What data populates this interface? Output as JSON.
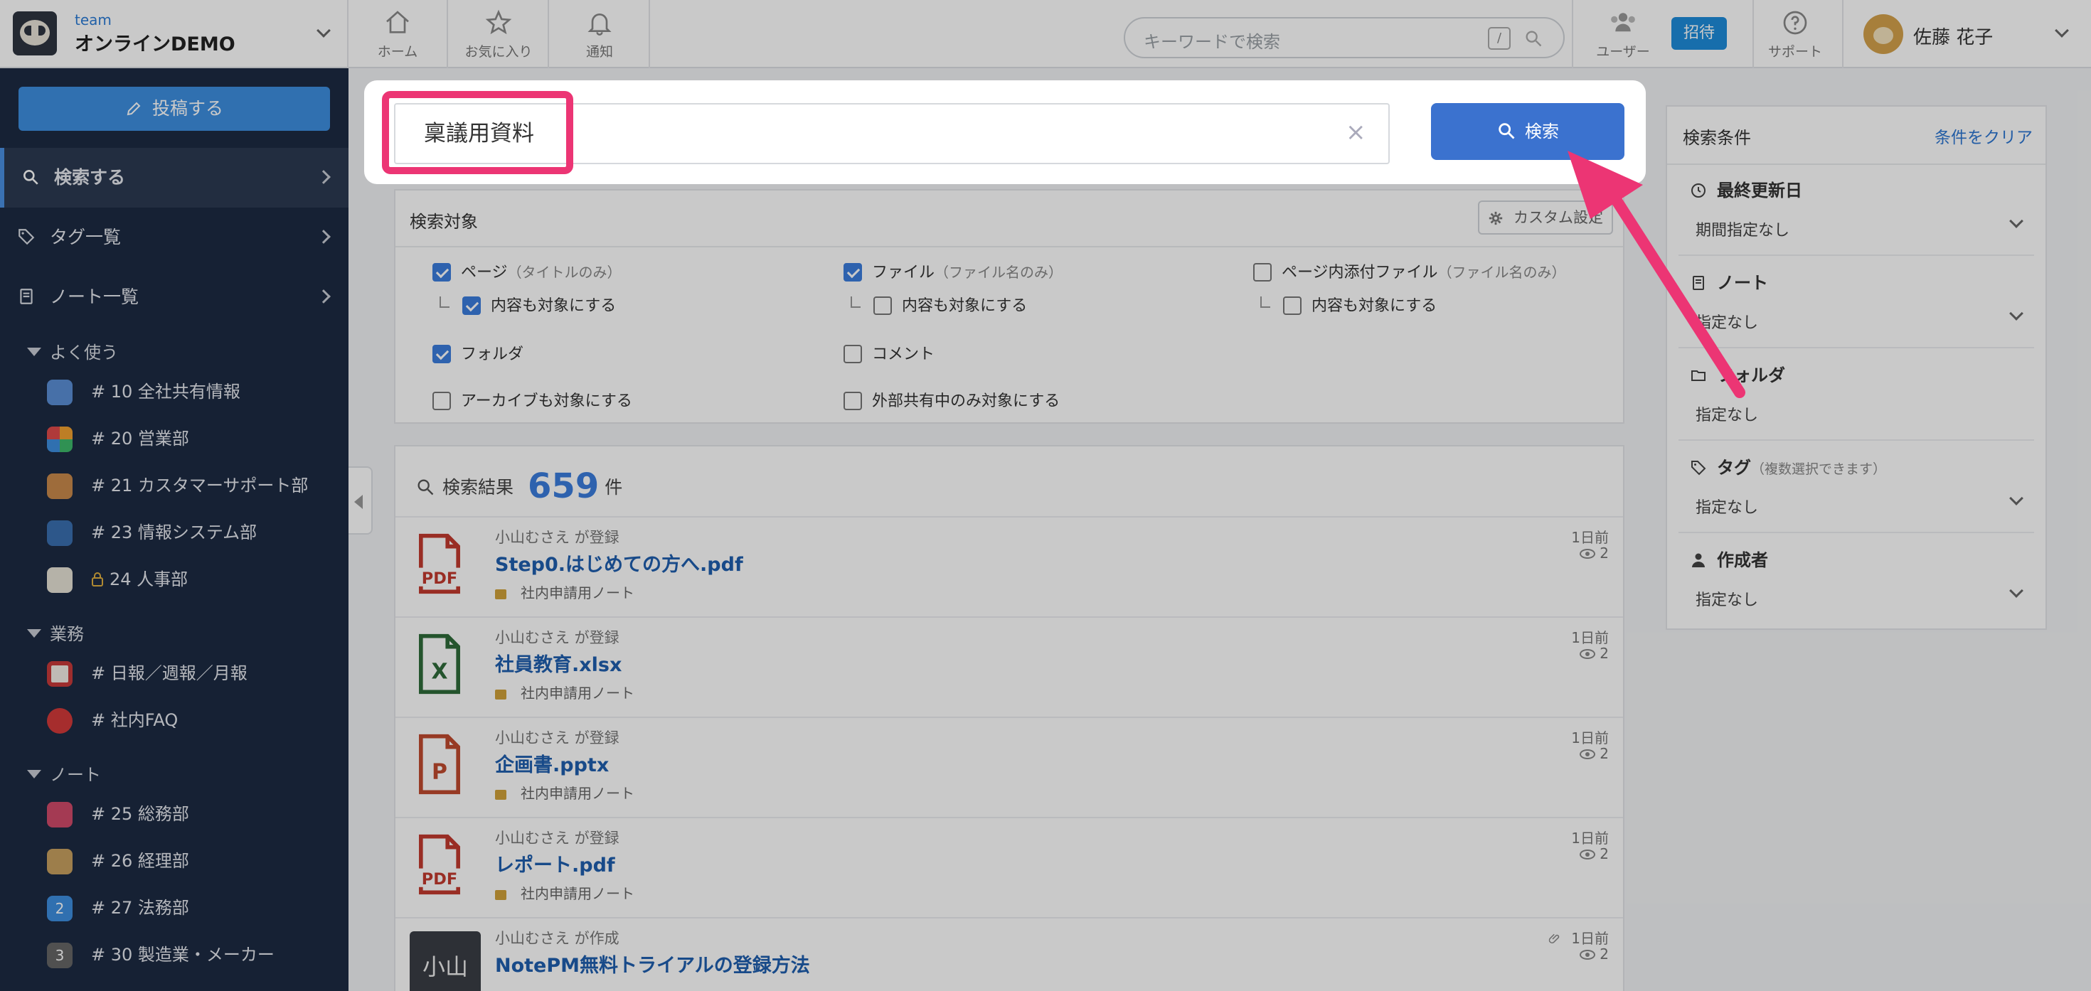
{
  "header": {
    "team_label": "team",
    "team_name": "オンラインDEMO",
    "nav": [
      {
        "label": "ホーム"
      },
      {
        "label": "お気に入り"
      },
      {
        "label": "通知"
      }
    ],
    "search_placeholder": "キーワードで検索",
    "search_shortcut": "/",
    "users_label": "ユーザー",
    "invite_label": "招待",
    "support_label": "サポート",
    "user_name": "佐藤 花子"
  },
  "sidebar": {
    "post_button": "投稿する",
    "menu": [
      {
        "label": "検索する"
      },
      {
        "label": "タグ一覧"
      },
      {
        "label": "ノート一覧"
      }
    ],
    "sections": [
      {
        "title": "よく使う",
        "items": [
          {
            "label": "# 10 全社共有情報",
            "icon_color": "#5b8fd6"
          },
          {
            "label": "# 20 営業部",
            "icon_color": "#f0a030"
          },
          {
            "label": "# 21 カスタマーサポート部",
            "icon_color": "#c98a4b"
          },
          {
            "label": "# 23 情報システム部",
            "icon_color": "#3a6fb0"
          },
          {
            "label": "24 人事部",
            "icon_color": "#e6e2d6"
          }
        ]
      },
      {
        "title": "業務",
        "items": [
          {
            "label": "# 日報／週報／月報",
            "icon_color": "#c83a3a"
          },
          {
            "label": "# 社内FAQ",
            "icon_color": "#d33a3a"
          }
        ]
      },
      {
        "title": "ノート",
        "items": [
          {
            "label": "# 25 総務部",
            "icon_color": "#d04a6a"
          },
          {
            "label": "# 26 経理部",
            "icon_color": "#c8a060"
          },
          {
            "label": "# 27 法務部",
            "icon_color": "#3d8ee0",
            "badge": "2"
          },
          {
            "label": "# 30 製造業・メーカー",
            "icon_color": "#666666",
            "badge": "3"
          }
        ]
      }
    ]
  },
  "search": {
    "query": "稟議用資料",
    "clear_icon": "×",
    "button_label": "検索"
  },
  "targets": {
    "title": "検索対象",
    "custom_button": "カスタム設定",
    "options": [
      {
        "label": "ページ",
        "sub": "（タイトルのみ）",
        "checked": true
      },
      {
        "label": "内容も対象にする",
        "checked": true
      },
      {
        "label": "ファイル",
        "sub": "（ファイル名のみ）",
        "checked": true
      },
      {
        "label": "内容も対象にする",
        "checked": false
      },
      {
        "label": "ページ内添付ファイル",
        "sub": "（ファイル名のみ）",
        "checked": false
      },
      {
        "label": "内容も対象にする",
        "checked": false
      },
      {
        "label": "フォルダ",
        "checked": true
      },
      {
        "label": "コメント",
        "checked": false
      },
      {
        "label": "アーカイブも対象にする",
        "checked": false
      },
      {
        "label": "外部共有中のみ対象にする",
        "checked": false
      }
    ]
  },
  "results": {
    "label": "検索結果",
    "count": "659",
    "unit": "件",
    "items": [
      {
        "meta": "小山むさえ が登録",
        "title": "Step0.はじめての方へ.pdf",
        "note": "社内申請用ノート",
        "date": "1日前",
        "views": "2",
        "type": "pdf"
      },
      {
        "meta": "小山むさえ が登録",
        "title": "社員教育.xlsx",
        "note": "社内申請用ノート",
        "date": "1日前",
        "views": "2",
        "type": "xlsx"
      },
      {
        "meta": "小山むさえ が登録",
        "title": "企画書.pptx",
        "note": "社内申請用ノート",
        "date": "1日前",
        "views": "2",
        "type": "pptx"
      },
      {
        "meta": "小山むさえ が登録",
        "title": "レポート.pdf",
        "note": "社内申請用ノート",
        "date": "1日前",
        "views": "2",
        "type": "pdf"
      },
      {
        "meta": "小山むさえ が作成",
        "title": "NotePM無料トライアルの登録方法",
        "note": "",
        "date": "1日前",
        "views": "2",
        "type": "page",
        "avatar_text": "小山"
      }
    ]
  },
  "conditions": {
    "title": "検索条件",
    "clear": "条件をクリア",
    "sections": [
      {
        "label": "最終更新日",
        "value": "期間指定なし",
        "dropdown": true,
        "icon": "clock-icon"
      },
      {
        "label": "ノート",
        "value": "指定なし",
        "dropdown": true,
        "icon": "notebook-icon"
      },
      {
        "label": "フォルダ",
        "value": "指定なし",
        "dropdown": false,
        "icon": "folder-icon"
      },
      {
        "label": "タグ",
        "sub": "（複数選択できます）",
        "value": "指定なし",
        "dropdown": true,
        "icon": "tag-icon"
      },
      {
        "label": "作成者",
        "value": "指定なし",
        "dropdown": true,
        "icon": "person-icon"
      }
    ]
  },
  "colors": {
    "accent": "#3b7ddd",
    "highlight": "#ec3574",
    "sidebar": "#1c2a42"
  }
}
